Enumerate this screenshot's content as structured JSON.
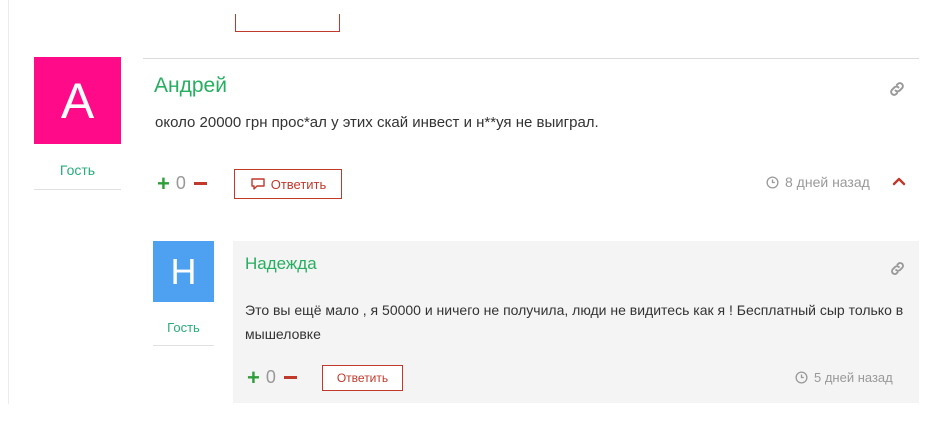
{
  "comments": [
    {
      "avatar_letter": "A",
      "avatar_color": "#ff0a88",
      "author": "Андрей",
      "role": "Гость",
      "text": "около 20000 грн прос*ал у этих скай инвест и н**уя не выиграл.",
      "votes": "0",
      "reply_label": "Ответить",
      "time": "8 дней назад"
    },
    {
      "avatar_letter": "H",
      "avatar_color": "#4ea1f0",
      "author": "Надежда",
      "role": "Гость",
      "text": "Это вы ещё мало , я 50000 и ничего не получила, люди не видитесь как я ! Бесплатный сыр только в мышеловке",
      "votes": "0",
      "reply_label": "Ответить",
      "time": "5 дней назад"
    }
  ],
  "icons": {
    "link": "link-icon",
    "reply": "speech-bubble-icon",
    "clock": "clock-icon",
    "upvote": "plus-icon",
    "downvote": "minus-icon",
    "collapse": "chevron-up-icon"
  },
  "colors": {
    "author": "#27ae60",
    "accent": "#c0392b",
    "upvote": "#2e9e3a",
    "muted": "#999999",
    "reply_background": "#f4f4f4"
  }
}
